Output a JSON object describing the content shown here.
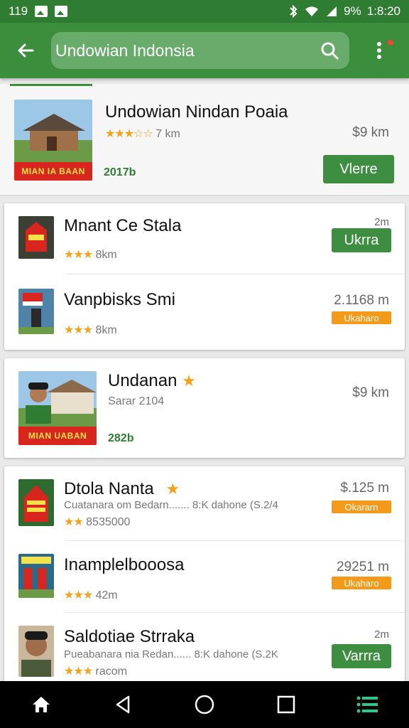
{
  "status": {
    "time": "1:8:20",
    "left_text": "119",
    "battery": "9%"
  },
  "search": {
    "query": "Undowian Indonsia"
  },
  "featured": {
    "title": "Undowian Nindan Poaia",
    "stars": "★★★☆☆",
    "distance": "7 km",
    "price": "$9 km",
    "code": "2017b",
    "button": "Vlerre",
    "banner": "MIAN IA BAAN"
  },
  "group1": [
    {
      "title": "Mnant Ce Stala",
      "stars": "★★★",
      "distance": "8km",
      "price": "2m",
      "button": "Ukrra",
      "button_type": "green",
      "banner": ""
    },
    {
      "title": "Vanpbisks Smi",
      "stars": "★★★",
      "distance": "8km",
      "price": "2.1168 m",
      "button": "Ukaharo",
      "button_type": "orange",
      "banner": ""
    }
  ],
  "card2": {
    "title": "Undanan",
    "sub": "Sarar 2104",
    "price": "$9 km",
    "code": "282b",
    "banner": "MIAN UABAN"
  },
  "group3": [
    {
      "title": "Dtola Nanta",
      "star": "★",
      "desc": "Cuatanara om Bedarn....... 8:K dahone (S.2/4",
      "stars": "★★",
      "distance": "8535000",
      "price": "$.125 m",
      "button": "Okararn",
      "button_type": "orange"
    },
    {
      "title": "Inamplelbooosa",
      "star": "",
      "desc": "",
      "stars": "★★★",
      "distance": "42m",
      "price": "29251 m",
      "button": "Ukaharo",
      "button_type": "orange"
    },
    {
      "title": "Saldotiae Strraka",
      "star": "",
      "desc": "Pueabanara nia Redan......  8:K dahone (S.2K",
      "stars": "★★★",
      "distance": "racom",
      "price": "2m",
      "button": "Varrra",
      "button_type": "green"
    }
  ],
  "colors": {
    "primary": "#3b8f3c",
    "accent": "#f39a1a",
    "star": "#f2a31b"
  },
  "icons": [
    "back-arrow-icon",
    "search-icon",
    "more-vert-icon",
    "home-icon",
    "back-triangle-icon",
    "home-circle-icon",
    "recents-square-icon",
    "list-icon"
  ]
}
